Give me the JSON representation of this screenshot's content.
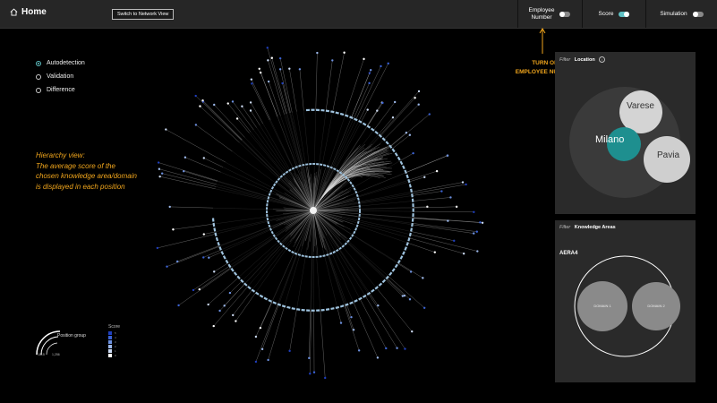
{
  "header": {
    "home_label": "Home",
    "switch_label": "Switch to Network View",
    "employee_label_line1": "Employee",
    "employee_label_line2": "Number",
    "score_label": "Score",
    "simulation_label": "Simulation"
  },
  "toggles": {
    "employee_number": false,
    "score": true,
    "simulation": false
  },
  "radio_options": [
    {
      "label": "Autodetection",
      "selected": true
    },
    {
      "label": "Validation",
      "selected": false
    },
    {
      "label": "Difference",
      "selected": false
    }
  ],
  "hierarchy_note": {
    "line1": "Hierarchy view:",
    "line2": "The average score of the",
    "line3": "chosen knowledge area/domain",
    "line4": "is displayed in each position"
  },
  "annotation": {
    "line1": "TURN ON",
    "line2": "EMPLOYEE NUMBER"
  },
  "location_panel": {
    "filter_label": "Filter",
    "title": "Location",
    "circles": [
      {
        "label": "Varese",
        "color": "#cfcfcf"
      },
      {
        "label": "Milano",
        "color": "#1e8f8f"
      },
      {
        "label": "Pavia",
        "color": "#cfcfcf"
      }
    ]
  },
  "knowledge_panel": {
    "filter_label": "Filter",
    "title": "Knowledge Areas",
    "area_label": "AERA4",
    "domains": [
      "DOMAIN 1",
      "DOMAIN 2"
    ]
  },
  "legend": {
    "position_group_label": "Position group",
    "scale_min": "1815",
    "scale_max": "1,256",
    "score_title": "Score",
    "score_levels": [
      "5",
      "4",
      "3",
      "2",
      "1",
      "0"
    ],
    "score_colors": [
      "#1f3fbf",
      "#3b63d6",
      "#6c90e0",
      "#9db9ec",
      "#cddcf5",
      "#ffffff"
    ]
  },
  "colors": {
    "accent": "#5fc1c4",
    "highlight": "#f0a51c"
  }
}
